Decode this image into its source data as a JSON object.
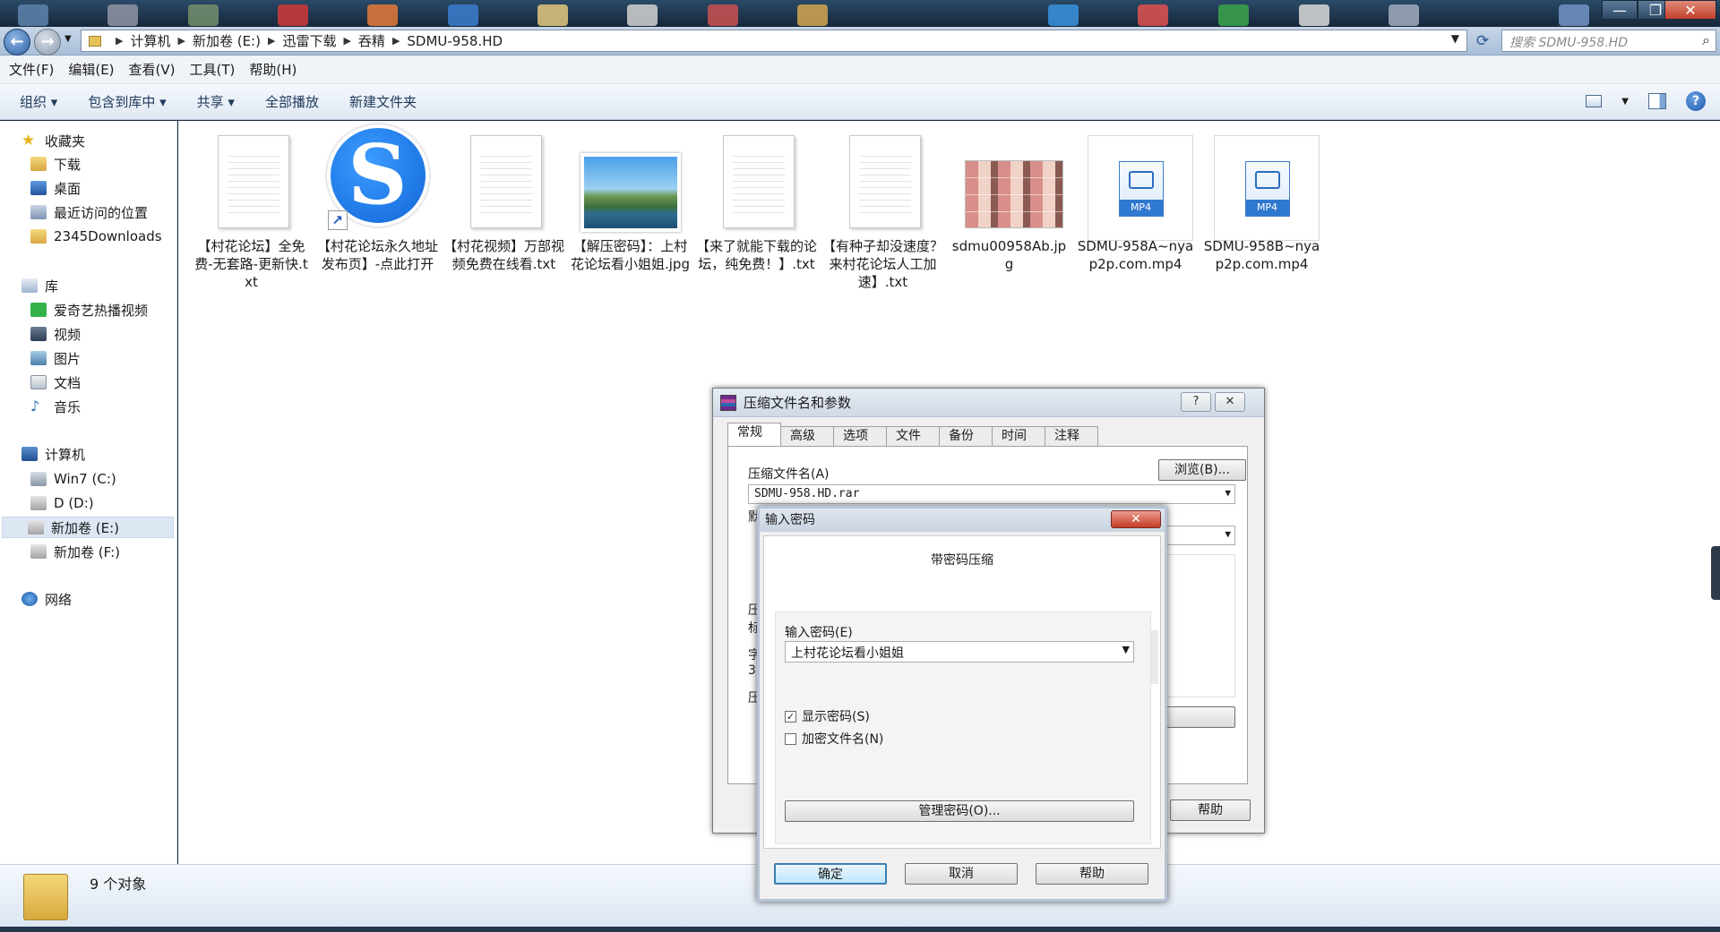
{
  "window": {
    "minimize_label": "—",
    "maximize_label": "❐",
    "close_label": "✕"
  },
  "address": {
    "breadcrumbs": [
      "计算机",
      "新加卷 (E:)",
      "迅雷下载",
      "吞精",
      "SDMU-958.HD"
    ],
    "search_placeholder": "搜索 SDMU-958.HD"
  },
  "menu": [
    "文件(F)",
    "编辑(E)",
    "查看(V)",
    "工具(T)",
    "帮助(H)"
  ],
  "commands": [
    "组织 ▾",
    "包含到库中 ▾",
    "共享 ▾",
    "全部播放",
    "新建文件夹"
  ],
  "nav": {
    "favorites": {
      "header": "收藏夹",
      "items": [
        "下载",
        "桌面",
        "最近访问的位置",
        "2345Downloads"
      ]
    },
    "libraries": {
      "header": "库",
      "items": [
        "爱奇艺热播视频",
        "视频",
        "图片",
        "文档",
        "音乐"
      ]
    },
    "computer": {
      "header": "计算机",
      "items": [
        "Win7 (C:)",
        "D (D:)",
        "新加卷 (E:)",
        "新加卷 (F:)"
      ],
      "selected": "新加卷 (E:)"
    },
    "network": {
      "header": "网络"
    }
  },
  "files": [
    {
      "name": "【村花论坛】全免费-无套路-更新快.txt",
      "type": "txt-icon"
    },
    {
      "name": "【村花论坛永久地址发布页】-点此打开",
      "type": "shortcut-icon",
      "glyph": "S"
    },
    {
      "name": "【村花视频】万部视频免费在线看.txt",
      "type": "txt-icon"
    },
    {
      "name": "【解压密码】：上村花论坛看小姐姐.jpg",
      "type": "image-thumbnail"
    },
    {
      "name": "【来了就能下载的论坛，纯免费！】.txt",
      "type": "txt-icon"
    },
    {
      "name": "【有种子却没速度？来村花论坛人工加速】.txt",
      "type": "txt-icon"
    },
    {
      "name": "sdmu00958Ab.jpg",
      "type": "image-thumbnail"
    },
    {
      "name": "SDMU-958A~nyap2p.com.mp4",
      "type": "mp4-icon",
      "tag": "MP4"
    },
    {
      "name": "SDMU-958B~nyap2p.com.mp4",
      "type": "mp4-icon",
      "tag": "MP4"
    }
  ],
  "status": {
    "count": "9 个对象"
  },
  "archive_dialog": {
    "title": "压缩文件名和参数",
    "help_icon": "?",
    "close_icon": "✕",
    "tabs": [
      "常规",
      "高级",
      "选项",
      "文件",
      "备份",
      "时间",
      "注释"
    ],
    "active_tab": "常规",
    "archive_name_label": "压缩文件名(A)",
    "archive_name_value": "SDMU-958.HD.rar",
    "browse_label": "浏览(B)...",
    "partial_labels": [
      "默",
      "压",
      "标",
      "字",
      "3",
      "压"
    ],
    "help_label": "帮助"
  },
  "password_dialog": {
    "title": "输入密码",
    "close_icon": "✕",
    "heading": "带密码压缩",
    "password_label": "输入密码(E)",
    "password_value": "上村花论坛看小姐姐",
    "show_password_label": "显示密码(S)",
    "show_password_checked": true,
    "encrypt_names_label": "加密文件名(N)",
    "encrypt_names_checked": false,
    "manage_label": "管理密码(O)...",
    "ok_label": "确定",
    "cancel_label": "取消",
    "help_label": "帮助"
  }
}
